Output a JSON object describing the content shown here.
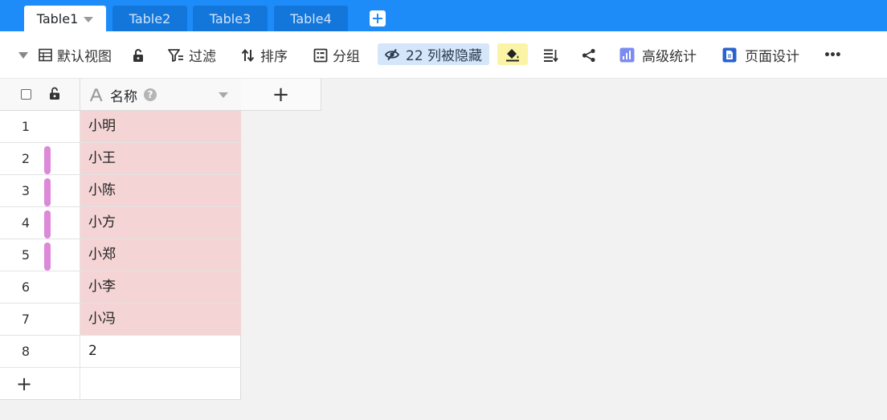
{
  "tabs": [
    {
      "label": "Table1",
      "active": true
    },
    {
      "label": "Table2",
      "active": false
    },
    {
      "label": "Table3",
      "active": false
    },
    {
      "label": "Table4",
      "active": false
    }
  ],
  "toolbar": {
    "view_label": "默认视图",
    "filter_label": "过滤",
    "sort_label": "排序",
    "group_label": "分组",
    "hidden_columns_label": "22 列被隐藏",
    "stats_label": "高级统计",
    "page_design_label": "页面设计",
    "more_label": "•••"
  },
  "grid": {
    "column_header": "名称",
    "help_glyph": "?",
    "add_column_glyph": "+",
    "add_row_glyph": "+",
    "rows": [
      {
        "index": "1",
        "name": "小明",
        "highlight": true,
        "marked": false
      },
      {
        "index": "2",
        "name": "小王",
        "highlight": true,
        "marked": true
      },
      {
        "index": "3",
        "name": "小陈",
        "highlight": true,
        "marked": true
      },
      {
        "index": "4",
        "name": "小方",
        "highlight": true,
        "marked": true
      },
      {
        "index": "5",
        "name": "小郑",
        "highlight": true,
        "marked": true
      },
      {
        "index": "6",
        "name": "小李",
        "highlight": true,
        "marked": false
      },
      {
        "index": "7",
        "name": "小冯",
        "highlight": true,
        "marked": false
      },
      {
        "index": "8",
        "name": "2",
        "highlight": false,
        "marked": false
      }
    ]
  },
  "colors": {
    "tabbar": "#1e8cf8",
    "row_highlight": "#f4d4d4",
    "row_marker": "#de88da",
    "hidden_chip": "#d5e6fb",
    "paint_chip": "#fbf4a6"
  },
  "icons": [
    "chevron-down-icon",
    "table-grid-icon",
    "unlock-icon",
    "filter-icon",
    "sort-icon",
    "group-icon",
    "eye-slash-icon",
    "paint-bucket-icon",
    "row-height-icon",
    "share-icon",
    "stats-icon",
    "page-design-icon",
    "more-icon",
    "text-field-icon",
    "help-icon",
    "plus-icon"
  ]
}
